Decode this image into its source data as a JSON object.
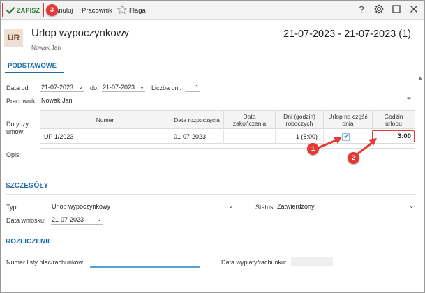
{
  "toolbar": {
    "save_label": "ZAPISZ",
    "cancel_label": "Anuluj",
    "employee_label": "Pracownik",
    "flag_label": "Flaga",
    "help_icon": "?",
    "settings_icon": "gear-icon",
    "maximize_icon": "square-icon",
    "close_icon": "close-icon"
  },
  "header": {
    "avatar": "UR",
    "title": "Urlop wypoczynkowy",
    "subtitle": "Nowak Jan",
    "date_range": "21-07-2023 - 21-07-2023 (1)"
  },
  "tabs": [
    {
      "label": "PODSTAWOWE",
      "active": true
    }
  ],
  "basic": {
    "date_from_label": "Data od:",
    "date_from": "21-07-2023",
    "date_to_label": "do:",
    "date_to": "21-07-2023",
    "days_label": "Liczba dni:",
    "days": "1",
    "employee_label": "Pracownik:",
    "employee": "Nowak Jan",
    "concerns_label_1": "Dotyczy",
    "concerns_label_2": "umów:",
    "description_label": "Opis:"
  },
  "contracts_table": {
    "columns": [
      "Numer",
      "Data rozpoczęcia",
      "Data zakończenia",
      "Dni (godzin) roboczych",
      "Urlop na część dnia",
      "Godzin urlopu"
    ],
    "rows": [
      {
        "number": "UP 1/2023",
        "start": "01-07-2023",
        "end": "",
        "days": "1  (8:00)",
        "partial_day": true,
        "hours": "3:00"
      }
    ]
  },
  "details": {
    "section_title": "SZCZEGÓŁY",
    "type_label": "Typ:",
    "type_value": "Urlop wypoczynkowy",
    "status_label": "Status:",
    "status_value": "Zatwierdzony",
    "request_date_label": "Data wniosku:",
    "request_date": "21-07-2023"
  },
  "settlement": {
    "section_title": "ROZLICZENIE",
    "payroll_label": "Numer listy płac/rachunków:",
    "payroll_value": "",
    "payment_date_label": "Data wypłaty/rachunku:",
    "payment_date_value": ""
  },
  "callouts": [
    "1",
    "2",
    "3"
  ],
  "colors": {
    "accent": "#1c6aa8",
    "callout": "#e53935",
    "save_green": "#2e7d32"
  }
}
